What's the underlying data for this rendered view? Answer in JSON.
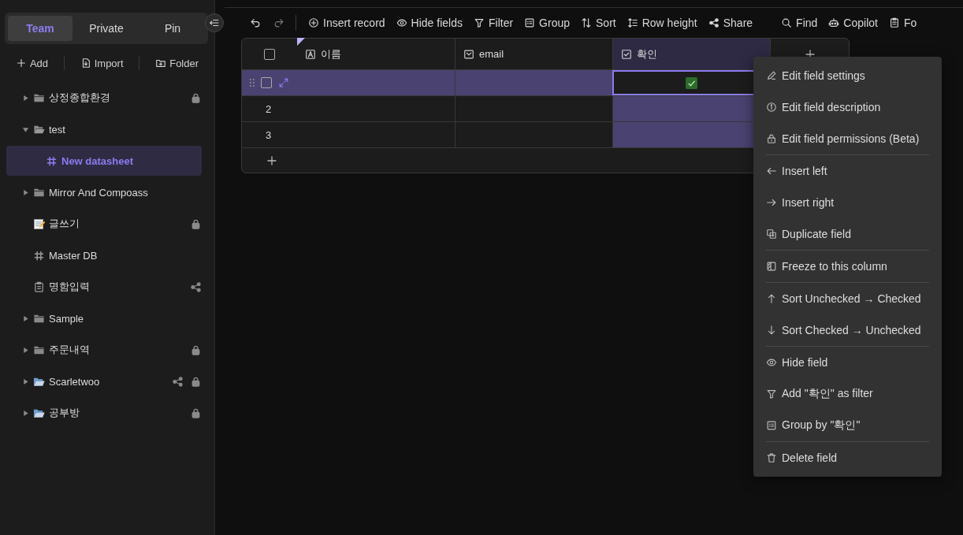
{
  "sidebar": {
    "tabs": [
      {
        "label": "Team",
        "selected": true
      },
      {
        "label": "Private",
        "selected": false
      },
      {
        "label": "Pin",
        "selected": false
      }
    ],
    "actions": [
      "Add",
      "Import",
      "Folder"
    ],
    "tree": [
      {
        "label": "상정종합환경",
        "kind": "folder",
        "expanded": false,
        "locked": true,
        "shared": false,
        "selected": false
      },
      {
        "label": "test",
        "kind": "folder",
        "expanded": true,
        "locked": false,
        "shared": false,
        "selected": false,
        "children": [
          {
            "label": "New datasheet",
            "kind": "datasheet",
            "locked": false,
            "shared": false,
            "selected": true
          }
        ]
      },
      {
        "label": "Mirror And Compoass",
        "kind": "folder",
        "expanded": false,
        "locked": false,
        "shared": false,
        "selected": false
      },
      {
        "label": "글쓰기",
        "kind": "memo",
        "locked": true,
        "shared": false,
        "selected": false
      },
      {
        "label": "Master DB",
        "kind": "datasheet",
        "locked": false,
        "shared": false,
        "selected": false
      },
      {
        "label": "명함입력",
        "kind": "form",
        "locked": false,
        "shared": true,
        "selected": false
      },
      {
        "label": "Sample",
        "kind": "folder",
        "expanded": false,
        "locked": false,
        "shared": false,
        "selected": false
      },
      {
        "label": "주문내역",
        "kind": "folder",
        "expanded": false,
        "locked": true,
        "shared": false,
        "selected": false
      },
      {
        "label": "Scarletwoo",
        "kind": "emoji-folder",
        "expanded": false,
        "locked": true,
        "shared": true,
        "selected": false
      },
      {
        "label": "공부방",
        "kind": "emoji-folder",
        "expanded": false,
        "locked": true,
        "shared": false,
        "selected": false
      }
    ]
  },
  "toolbar": {
    "left": [
      "Insert record",
      "Hide fields",
      "Filter",
      "Group",
      "Sort",
      "Row height",
      "Share"
    ],
    "right": [
      "Find",
      "Copilot",
      "Fo"
    ]
  },
  "table": {
    "select_all": false,
    "columns": [
      {
        "name": "이름",
        "kind": "text",
        "selected": false
      },
      {
        "name": "email",
        "kind": "email",
        "selected": false
      },
      {
        "name": "확인",
        "kind": "checkbox",
        "selected": true
      }
    ],
    "rows": [
      {
        "selected": true,
        "checked": true
      },
      {
        "number": "2",
        "selected": false,
        "checked": false
      },
      {
        "number": "3",
        "selected": false,
        "checked": false
      }
    ]
  },
  "menu": {
    "groups": [
      [
        "Edit field settings",
        "Edit field description",
        "Edit field permissions (Beta)"
      ],
      [
        "Insert left",
        "Insert right",
        "Duplicate field"
      ],
      [
        "Freeze to this column"
      ],
      [
        "Sort Unchecked → Checked",
        "Sort Checked → Unchecked"
      ],
      [
        "Hide field",
        "Add \"확인\" as filter",
        "Group by \"확인\""
      ],
      [
        "Delete field"
      ]
    ]
  }
}
